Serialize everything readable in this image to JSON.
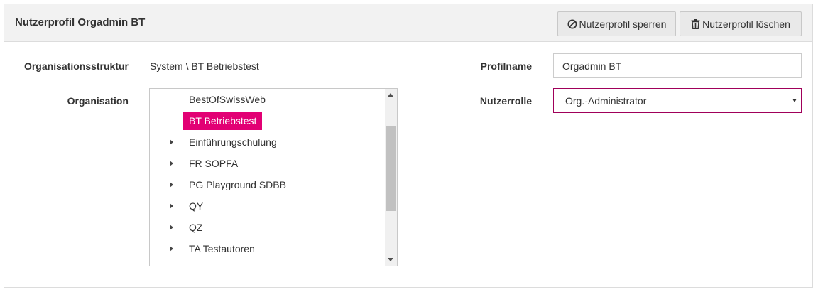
{
  "header": {
    "title": "Nutzerprofil Orgadmin BT",
    "lock_button": {
      "label": "Nutzerprofil sperren",
      "icon": "ban-icon"
    },
    "delete_button": {
      "label": "Nutzerprofil löschen",
      "icon": "trash-icon"
    }
  },
  "form": {
    "orgstruct_label": "Organisationsstruktur",
    "orgstruct_value": "System \\ BT Betriebstest",
    "organisation_label": "Organisation",
    "profilname_label": "Profilname",
    "profilname_value": "Orgadmin BT",
    "nutzerrolle_label": "Nutzerrolle",
    "nutzerrolle_value": "Org.-Administrator"
  },
  "tree": {
    "items": [
      {
        "label": "BestOfSwissWeb",
        "expandable": false,
        "selected": false
      },
      {
        "label": "BT Betriebstest",
        "expandable": false,
        "selected": true
      },
      {
        "label": "Einführungschulung",
        "expandable": true,
        "selected": false
      },
      {
        "label": "FR SOPFA",
        "expandable": true,
        "selected": false
      },
      {
        "label": "PG Playground SDBB",
        "expandable": true,
        "selected": false
      },
      {
        "label": "QY",
        "expandable": true,
        "selected": false
      },
      {
        "label": "QZ",
        "expandable": true,
        "selected": false
      },
      {
        "label": "TA Testautoren",
        "expandable": true,
        "selected": false
      }
    ]
  },
  "colors": {
    "accent": "#e20074",
    "select_border": "#a0005a",
    "header_bg": "#f2f2f2"
  }
}
